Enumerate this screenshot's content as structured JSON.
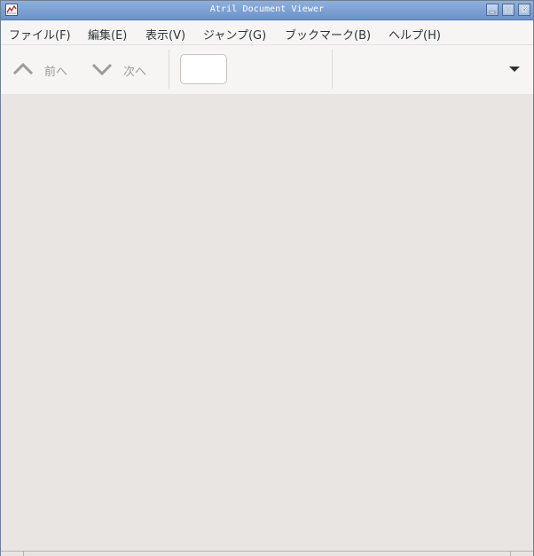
{
  "window": {
    "title": "Atril Document Viewer"
  },
  "menubar": {
    "items": [
      {
        "label": "ファイル(F)"
      },
      {
        "label": "編集(E)"
      },
      {
        "label": "表示(V)"
      },
      {
        "label": "ジャンプ(G)"
      },
      {
        "label": "ブックマーク(B)"
      },
      {
        "label": "ヘルプ(H)"
      }
    ]
  },
  "toolbar": {
    "prev_label": "前へ",
    "next_label": "次へ",
    "page_entry_value": "",
    "prev_icon": "chevron-up-icon",
    "next_icon": "chevron-down-icon",
    "menu_icon": "triangle-down-icon"
  },
  "colors": {
    "titlebar": "#7a9fd4",
    "document_background": "#e8e5e2",
    "toolbar_background": "#f6f5f4",
    "disabled_text": "#9b9b9b"
  }
}
